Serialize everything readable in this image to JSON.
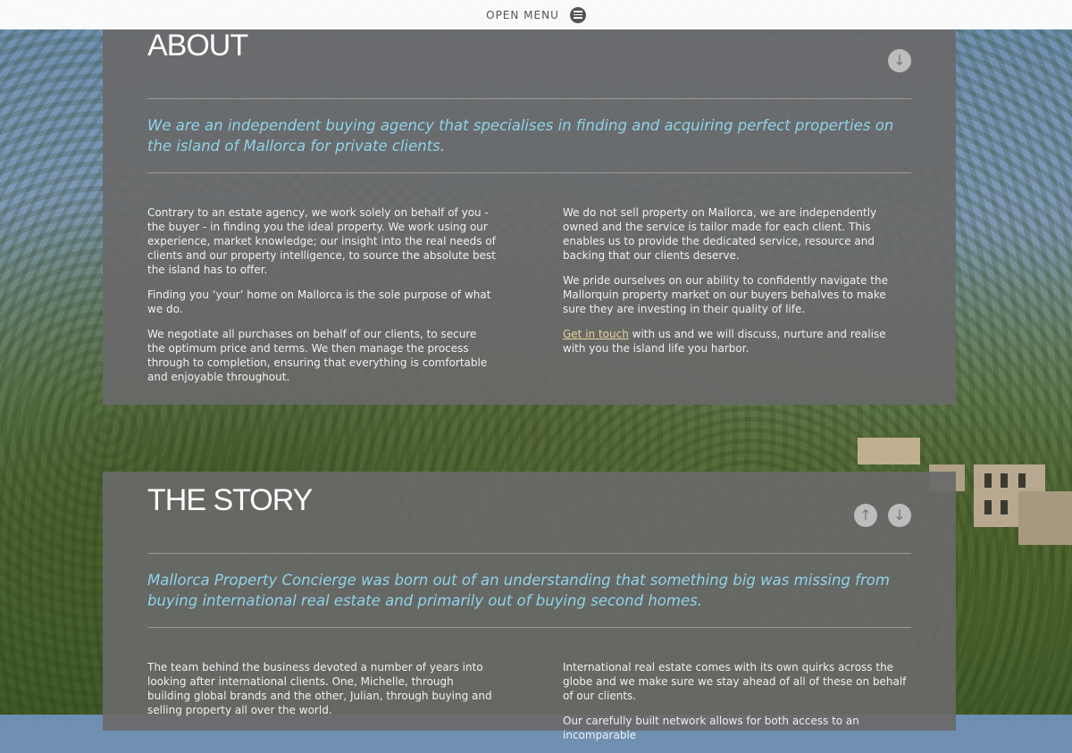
{
  "menu": {
    "label": "OPEN MENU",
    "icon": "menu-icon"
  },
  "about": {
    "title": "ABOUT",
    "lead": "We are an independent buying agency that specialises in finding and acquiring perfect properties on the island of Mallorca for private clients.",
    "left": [
      "Contrary to an estate agency, we work solely on behalf of you - the buyer - in finding you the ideal property. We work using our experience, market knowledge; our insight into the real needs of clients and our property intelligence, to source the absolute best the island has to offer.",
      "Finding you ‘your’ home on Mallorca is the sole purpose of what we do.",
      "We negotiate all purchases on behalf of our clients, to secure the optimum price and terms. We then manage the process through to completion, ensuring that everything is comfortable and enjoyable throughout."
    ],
    "right": [
      "We do not sell property on Mallorca, we are independently owned and the service is tailor made for each client. This enables us to provide the dedicated service, resource and backing that our clients deserve.",
      "We pride ourselves on our ability to confidently navigate the Mallorquin property market on our buyers behalves to make sure they are investing in their quality of life."
    ],
    "contact_link": "Get in touch",
    "contact_text": " with us and we will discuss, nurture and realise with you the island life you harbor."
  },
  "story": {
    "title": "THE STORY",
    "lead": "Mallorca Property Concierge was born out of an understanding that something big was missing from buying international real estate and primarily out of buying second homes.",
    "left": [
      "The team behind the business devoted a number of years into looking after international clients. One, Michelle, through building global brands and the other, Julian, through buying and selling property all over the world."
    ],
    "right": [
      "International real estate comes with its own quirks across the globe and we make sure we stay ahead of all of these on behalf of our clients.",
      "Our carefully built network allows for both access to an incomparable"
    ]
  },
  "icons": {
    "down": "arrow-down-icon",
    "up": "arrow-up-icon"
  },
  "colors": {
    "accent": "#8fd3ea",
    "panel": "#696969",
    "link": "#e8d3a0"
  }
}
